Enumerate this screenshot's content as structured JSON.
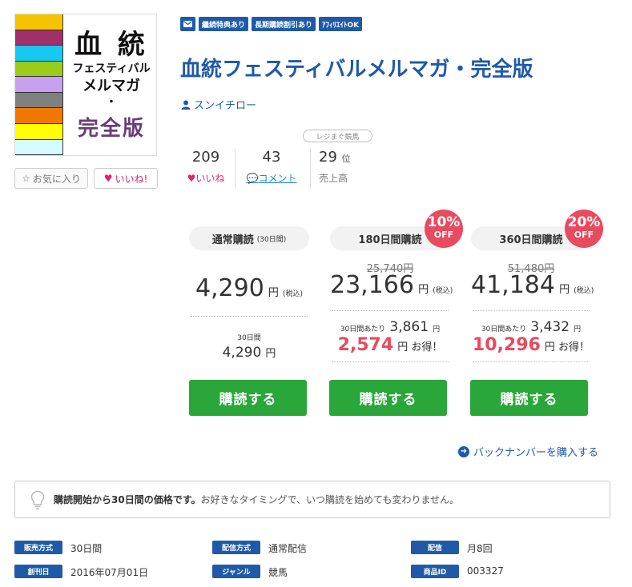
{
  "cover": {
    "line1": "血 統",
    "line2": "フェスティバル",
    "line3": "メルマガ",
    "line4": "・",
    "line5": "完全版",
    "stripe_colors": [
      "#f5c400",
      "#a0306a",
      "#19c8f0",
      "#9ccc1a",
      "#c8a0f0",
      "#808080",
      "#f07800",
      "#ffff00",
      "#d4fbff"
    ]
  },
  "buttons": {
    "favorite_label": "お気に入り",
    "like_label": "いいね!"
  },
  "tags": [
    "繼続特典あり",
    "長期購読割引あり",
    "ｱﾌｨﾘｴｲﾄOK"
  ],
  "title": "血統フェスティバルメルマガ・完全版",
  "author": "スンイチロー",
  "stats": {
    "likes": {
      "value": "209",
      "label": "いいね"
    },
    "comments": {
      "value": "43",
      "label": "コメント"
    },
    "rank": {
      "badge": "レジまぐ競馬",
      "value": "29",
      "suffix": "位",
      "label": "売上高"
    }
  },
  "plans": [
    {
      "name": "通常購読",
      "period_note": "(30日間)",
      "original_price": "",
      "price": "4,290",
      "unit": "円",
      "tax": "(税込)",
      "monthly_label": "30日間",
      "monthly_price": "4,290",
      "monthly_unit": "円",
      "savings": "",
      "savings_suffix": "",
      "button": "購読する",
      "discount": ""
    },
    {
      "name": "180日間購読",
      "period_note": "",
      "original_price": "25,740円",
      "price": "23,166",
      "unit": "円",
      "tax": "(税込)",
      "monthly_label": "30日間あたり",
      "monthly_price": "3,861",
      "monthly_unit": "円",
      "savings": "2,574",
      "savings_suffix": "円 お得！",
      "button": "購読する",
      "discount_pct": "10%",
      "discount_off": "OFF"
    },
    {
      "name": "360日間購読",
      "period_note": "",
      "original_price": "51,480円",
      "price": "41,184",
      "unit": "円",
      "tax": "(税込)",
      "monthly_label": "30日間あたり",
      "monthly_price": "3,432",
      "monthly_unit": "円",
      "savings": "10,296",
      "savings_suffix": "円 お得！",
      "button": "購読する",
      "discount_pct": "20%",
      "discount_off": "OFF"
    }
  ],
  "backnumber_link": "バックナンバーを購入する",
  "notice": {
    "bold": "購読開始から30日間の価格です。",
    "text": "お好きなタイミングで、いつ購読を始めても変わりません。"
  },
  "meta": [
    {
      "label": "販売方式",
      "value": "30日間"
    },
    {
      "label": "配信方式",
      "value": "通常配信"
    },
    {
      "label": "配信",
      "value": "月8回"
    },
    {
      "label": "創刊日",
      "value": "2016年07月01日"
    },
    {
      "label": "ジャンル",
      "value": "競馬"
    },
    {
      "label": "商品ID",
      "value": "003327"
    }
  ],
  "colors": {
    "brand_blue": "#1e5aa8",
    "buy_green": "#2aa63a",
    "accent_red": "#e84a5f",
    "like_pink": "#e0216b"
  }
}
